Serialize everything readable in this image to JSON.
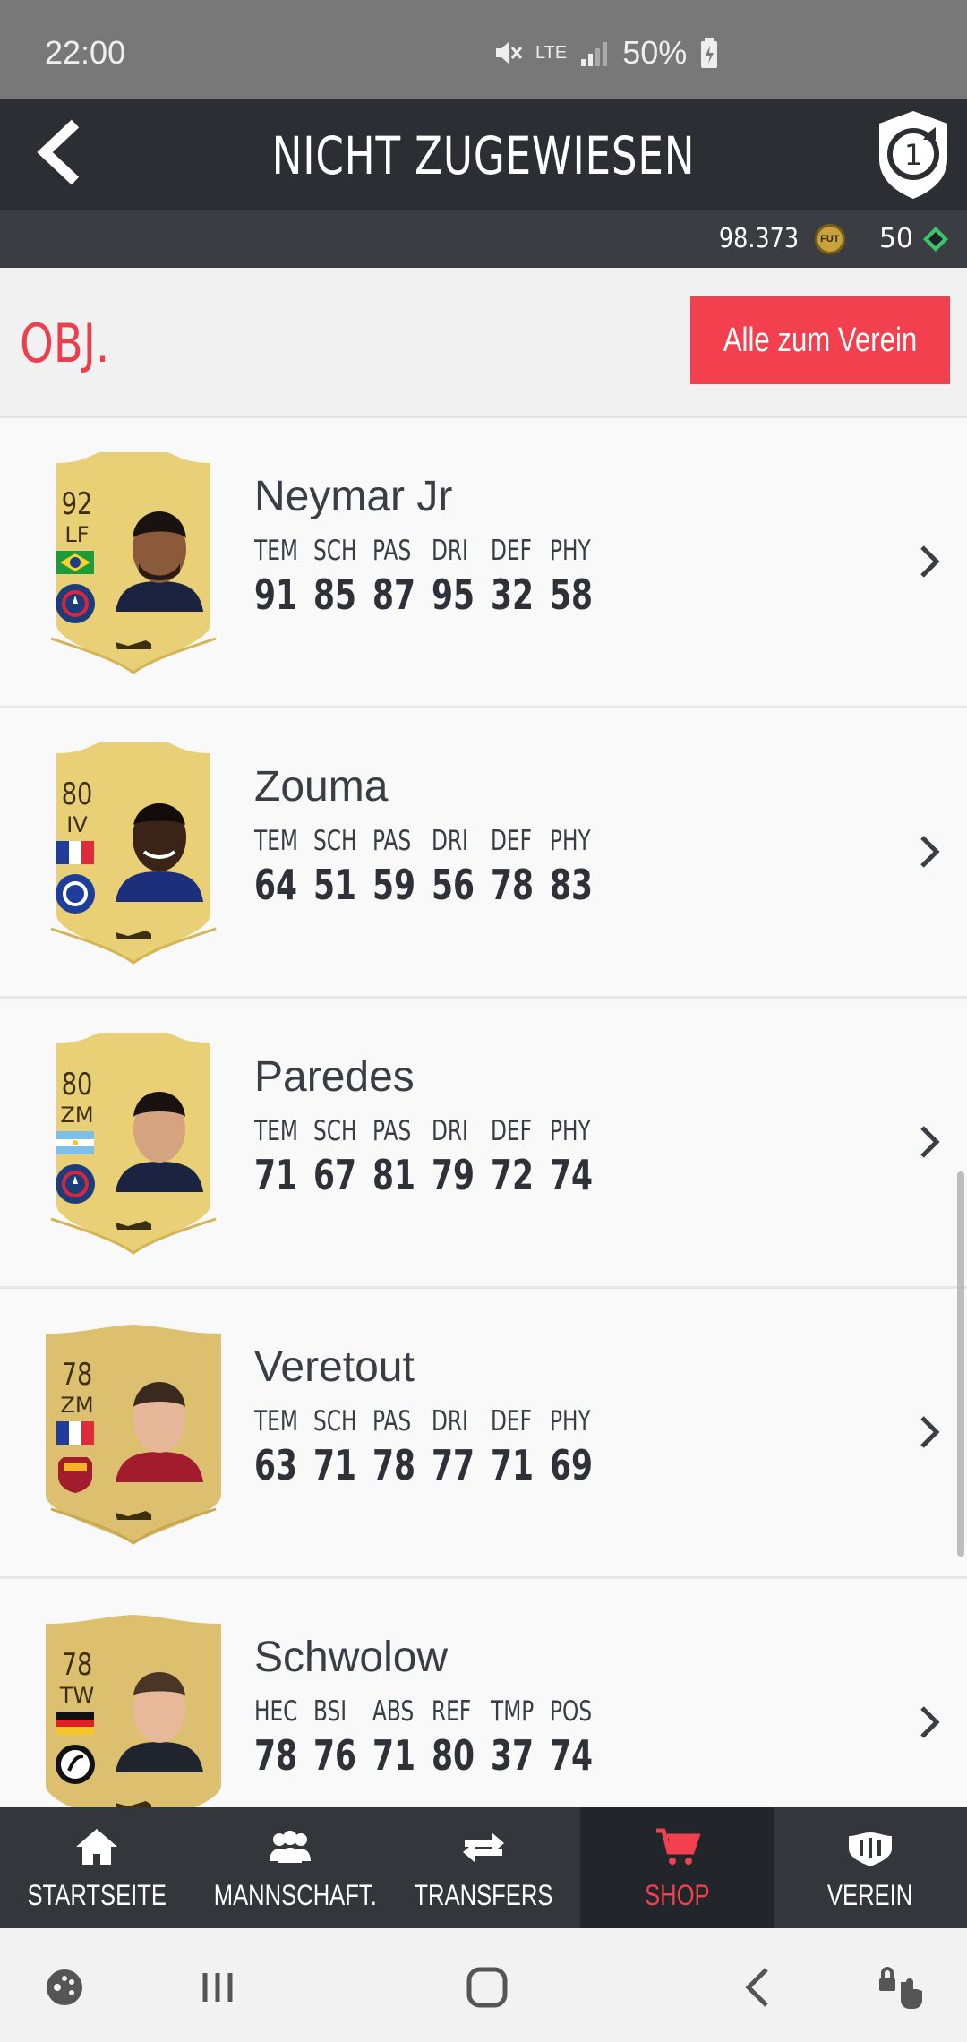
{
  "status_bar": {
    "time": "22:00",
    "battery": "50%",
    "network": "LTE"
  },
  "header": {
    "title": "NICHT ZUGEWIESEN",
    "objectives_badge": "1"
  },
  "currency": {
    "coins": "98.373",
    "coin_label": "FUT",
    "points": "50"
  },
  "objects_bar": {
    "label": "OBJ.",
    "send_all_button": "Alle zum Verein"
  },
  "players": [
    {
      "name": "Neymar Jr",
      "rating": "92",
      "position": "LF",
      "stats": [
        {
          "label": "TEM",
          "value": "91"
        },
        {
          "label": "SCH",
          "value": "85"
        },
        {
          "label": "PAS",
          "value": "87"
        },
        {
          "label": "DRI",
          "value": "95"
        },
        {
          "label": "DEF",
          "value": "32"
        },
        {
          "label": "PHY",
          "value": "58"
        }
      ]
    },
    {
      "name": "Zouma",
      "rating": "80",
      "position": "IV",
      "stats": [
        {
          "label": "TEM",
          "value": "64"
        },
        {
          "label": "SCH",
          "value": "51"
        },
        {
          "label": "PAS",
          "value": "59"
        },
        {
          "label": "DRI",
          "value": "56"
        },
        {
          "label": "DEF",
          "value": "78"
        },
        {
          "label": "PHY",
          "value": "83"
        }
      ]
    },
    {
      "name": "Paredes",
      "rating": "80",
      "position": "ZM",
      "stats": [
        {
          "label": "TEM",
          "value": "71"
        },
        {
          "label": "SCH",
          "value": "67"
        },
        {
          "label": "PAS",
          "value": "81"
        },
        {
          "label": "DRI",
          "value": "79"
        },
        {
          "label": "DEF",
          "value": "72"
        },
        {
          "label": "PHY",
          "value": "74"
        }
      ]
    },
    {
      "name": "Veretout",
      "rating": "78",
      "position": "ZM",
      "stats": [
        {
          "label": "TEM",
          "value": "63"
        },
        {
          "label": "SCH",
          "value": "71"
        },
        {
          "label": "PAS",
          "value": "78"
        },
        {
          "label": "DRI",
          "value": "77"
        },
        {
          "label": "DEF",
          "value": "71"
        },
        {
          "label": "PHY",
          "value": "69"
        }
      ]
    },
    {
      "name": "Schwolow",
      "rating": "78",
      "position": "TW",
      "stats": [
        {
          "label": "HEC",
          "value": "78"
        },
        {
          "label": "BSI",
          "value": "76"
        },
        {
          "label": "ABS",
          "value": "71"
        },
        {
          "label": "REF",
          "value": "80"
        },
        {
          "label": "TMP",
          "value": "37"
        },
        {
          "label": "POS",
          "value": "74"
        }
      ]
    }
  ],
  "bottom_nav": [
    {
      "label": "STARTSEITE",
      "icon": "home-icon"
    },
    {
      "label": "MANNSCHAFT.",
      "icon": "team-icon"
    },
    {
      "label": "TRANSFERS",
      "icon": "transfer-arrows-icon"
    },
    {
      "label": "SHOP",
      "icon": "cart-icon"
    },
    {
      "label": "VEREIN",
      "icon": "club-icon"
    }
  ],
  "colors": {
    "accent": "#f2404f",
    "header_bg": "#2b2f33",
    "nav_bg": "#33373b",
    "card_gold": "#e9d077"
  }
}
